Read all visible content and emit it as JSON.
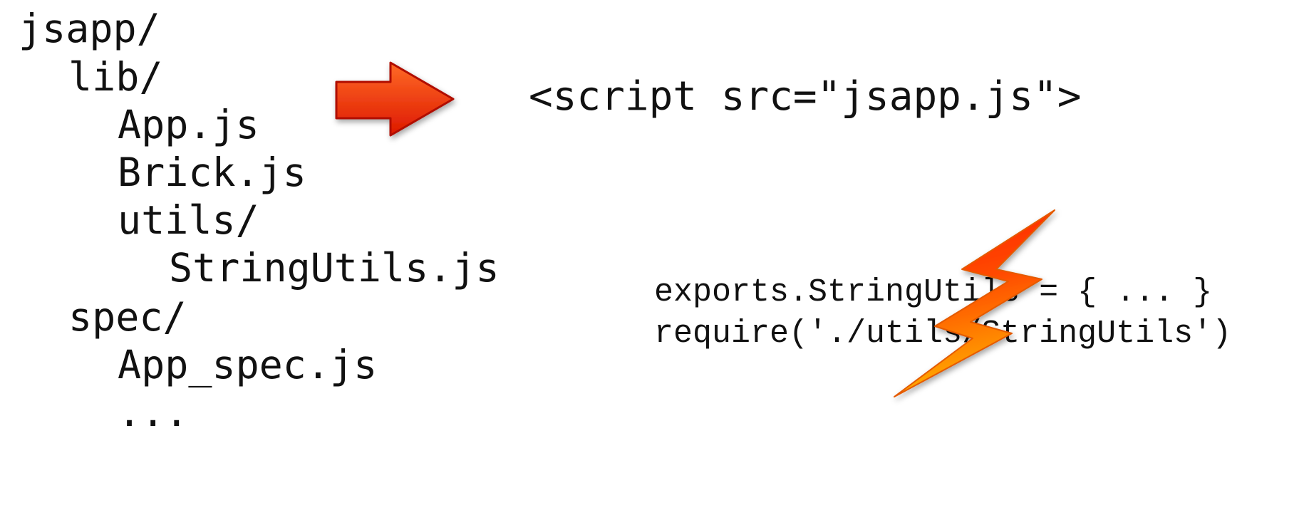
{
  "tree": {
    "items": [
      {
        "label": "jsapp/"
      },
      {
        "label": "lib/"
      },
      {
        "label": "App.js"
      },
      {
        "label": "Brick.js"
      },
      {
        "label": "utils/"
      },
      {
        "label": "StringUtils.js"
      },
      {
        "label": "spec/"
      },
      {
        "label": "App_spec.js"
      },
      {
        "label": "..."
      }
    ]
  },
  "script_tag": "<script src=\"jsapp.js\">",
  "code": {
    "lines": [
      "exports.StringUtils = { ... }",
      "require('./utils/StringUtils')"
    ]
  },
  "icons": {
    "arrow": "right-arrow-icon",
    "lightning": "lightning-bolt-icon"
  },
  "colors": {
    "arrow_fill_top": "#ff5a1a",
    "arrow_fill_bottom": "#e11a00",
    "bolt_fill_top": "#ff2a00",
    "bolt_fill_bottom": "#ffb000"
  }
}
